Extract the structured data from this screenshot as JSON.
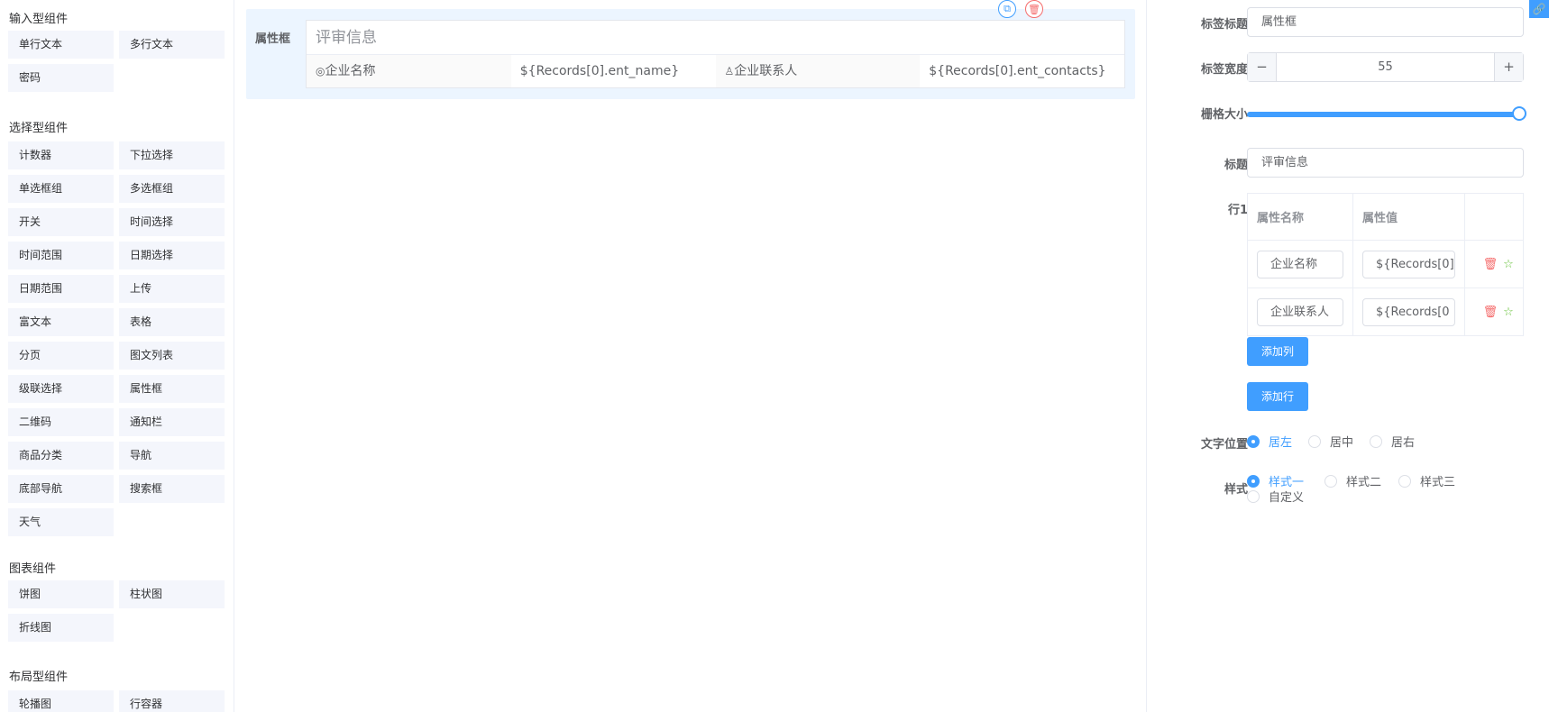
{
  "palette": {
    "groups": [
      {
        "title": "输入型组件",
        "items": [
          "单行文本",
          "多行文本",
          "密码"
        ]
      },
      {
        "title": "选择型组件",
        "items": [
          "计数器",
          "下拉选择",
          "单选框组",
          "多选框组",
          "开关",
          "时间选择",
          "时间范围",
          "日期选择",
          "日期范围",
          "上传",
          "富文本",
          "表格",
          "分页",
          "图文列表",
          "级联选择",
          "属性框",
          "二维码",
          "通知栏",
          "商品分类",
          "导航",
          "底部导航",
          "搜索框",
          "天气"
        ]
      },
      {
        "title": "图表组件",
        "items": [
          "饼图",
          "柱状图",
          "折线图"
        ]
      },
      {
        "title": "布局型组件",
        "items": [
          "轮播图",
          "行容器"
        ]
      }
    ]
  },
  "canvas": {
    "label": "属性框",
    "title": "评审信息",
    "row": [
      {
        "name": "企业名称",
        "name_icon": "company-icon",
        "value": "${Records[0].ent_name}"
      },
      {
        "name": "企业联系人",
        "name_icon": "user-icon",
        "value": "${Records[0].ent_contacts}"
      }
    ],
    "copy_icon": "copy-icon",
    "delete_icon": "delete-icon"
  },
  "props": {
    "label_title": {
      "label": "标签标题",
      "value": "属性框"
    },
    "label_width": {
      "label": "标签宽度",
      "value": "55",
      "minus": "−",
      "plus": "+"
    },
    "grid_size": {
      "label": "栅格大小",
      "value": 24,
      "max": 24
    },
    "title": {
      "label": "标题",
      "value": "评审信息"
    },
    "row1": {
      "label": "行1",
      "headers": [
        "属性名称",
        "属性值",
        ""
      ],
      "rows": [
        {
          "name": "企业名称",
          "value": "${Records[0]"
        },
        {
          "name": "企业联系人",
          "value": "${Records[0"
        }
      ]
    },
    "add_col": "添加列",
    "add_row": "添加行",
    "text_position": {
      "label": "文字位置",
      "options": [
        "居左",
        "居中",
        "居右"
      ],
      "selected": "居左"
    },
    "style": {
      "label": "样式",
      "options": [
        "样式一",
        "样式二",
        "样式三",
        "自定义"
      ],
      "selected": "样式一"
    }
  },
  "colors": {
    "accent": "#409eff",
    "danger": "#f56c6c",
    "success": "#67c23a"
  }
}
